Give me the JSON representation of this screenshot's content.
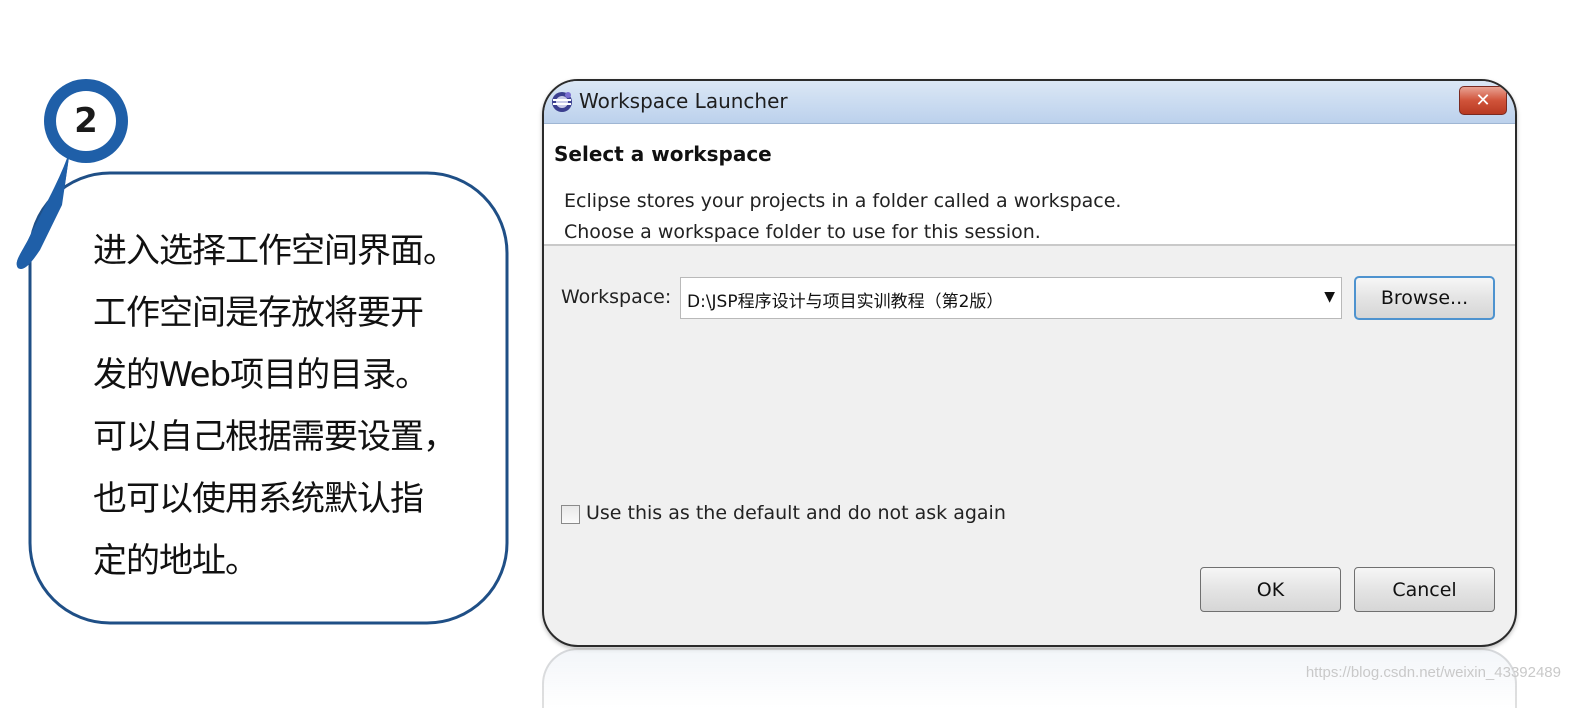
{
  "callout": {
    "step_number": "2",
    "lines": [
      "进入选择工作空间界面。",
      "工作空间是存放将要开",
      "发的Web项目的目录。",
      "可以自己根据需要设置，",
      "也可以使用系统默认指",
      "定的地址。"
    ],
    "accent_color": "#1f5fa8"
  },
  "dialog": {
    "title": "Workspace Launcher",
    "close_icon": "close-icon",
    "header": {
      "title": "Select a workspace",
      "desc_line1": "Eclipse stores your projects in a folder called a workspace.",
      "desc_line2": "Choose a workspace folder to use for this session."
    },
    "workspace": {
      "label": "Workspace:",
      "value": "D:\\JSP程序设计与项目实训教程（第2版）"
    },
    "browse_label": "Browse...",
    "default_checkbox": {
      "label": "Use this as the default and do not ask again",
      "checked": false
    },
    "ok_label": "OK",
    "cancel_label": "Cancel"
  },
  "watermark": "https://blog.csdn.net/weixin_43392489"
}
